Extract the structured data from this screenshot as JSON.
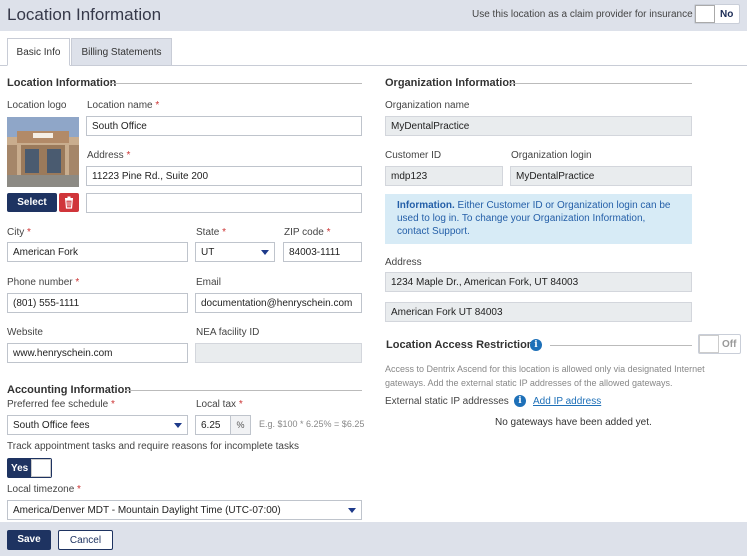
{
  "header": {
    "title": "Location Information",
    "claim_provider_label": "Use this location as a claim provider for insurance",
    "claim_provider_toggle": "No"
  },
  "tabs": [
    {
      "label": "Basic Info",
      "active": true
    },
    {
      "label": "Billing Statements",
      "active": false
    }
  ],
  "location": {
    "section_title": "Location Information",
    "logo_label": "Location logo",
    "select_button": "Select",
    "name_label": "Location name",
    "name_value": "South Office",
    "address_label": "Address",
    "address1_value": "11223 Pine Rd., Suite 200",
    "address2_value": "",
    "city_label": "City",
    "city_value": "American Fork",
    "state_label": "State",
    "state_value": "UT",
    "zip_label": "ZIP code",
    "zip_value": "84003-1111",
    "phone_label": "Phone number",
    "phone_value": "(801) 555-1111",
    "email_label": "Email",
    "email_value": "documentation@henryschein.com",
    "website_label": "Website",
    "website_value": "www.henryschein.com",
    "nea_label": "NEA facility ID",
    "nea_value": ""
  },
  "accounting": {
    "section_title": "Accounting Information",
    "fee_label": "Preferred fee schedule",
    "fee_value": "South Office fees",
    "tax_label": "Local tax",
    "tax_value": "6.25",
    "tax_unit": "%",
    "tax_example": "E.g. $100 * 6.25% = $6.25",
    "track_label": "Track appointment tasks and require reasons for incomplete tasks",
    "track_toggle": "Yes",
    "timezone_label": "Local timezone",
    "timezone_value": "America/Denver MDT - Mountain Daylight Time (UTC-07:00)"
  },
  "organization": {
    "section_title": "Organization Information",
    "name_label": "Organization name",
    "name_value": "MyDentalPractice",
    "customer_id_label": "Customer ID",
    "customer_id_value": "mdp123",
    "login_label": "Organization login",
    "login_value": "MyDentalPractice",
    "info_title": "Information.",
    "info_text": " Either Customer ID or Organization login can be used to log in. To change your Organization Information, contact Support.",
    "address_label": "Address",
    "address1_value": "1234 Maple Dr., American Fork, UT 84003",
    "address2_value": "American Fork UT 84003"
  },
  "access": {
    "section_title": "Location Access Restrictions",
    "toggle": "Off",
    "description": "Access to Dentrix Ascend for this location is allowed only via designated Internet gateways. Add the external static IP addresses of the allowed gateways.",
    "ip_label": "External static IP addresses",
    "add_link": "Add IP address",
    "empty_text": "No gateways have been added yet."
  },
  "footer": {
    "save": "Save",
    "cancel": "Cancel"
  },
  "colors": {
    "primary": "#1e3361",
    "header_bg": "#dde1ea",
    "required": "#cc3333",
    "info_bg": "#d7ebf6",
    "link": "#1e70b8",
    "delete": "#d0353a"
  },
  "icons": {
    "delete": "trash-icon",
    "dropdown": "chevron-down-icon",
    "info": "info-icon"
  }
}
